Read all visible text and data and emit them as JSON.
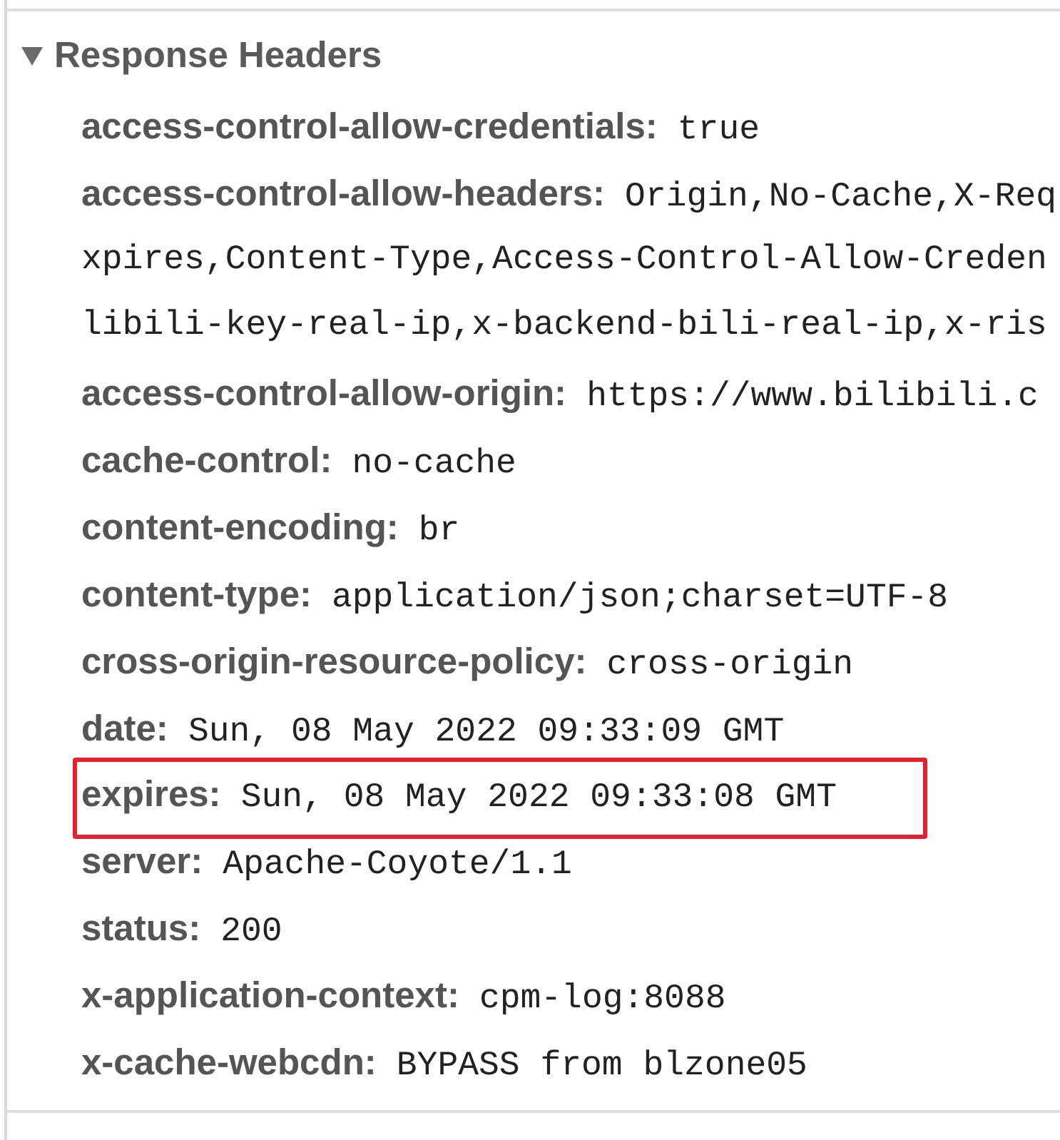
{
  "section": {
    "title": "Response Headers",
    "expanded": true
  },
  "headers": [
    {
      "name": "access-control-allow-credentials:",
      "value_lines": [
        "true"
      ],
      "highlighted": false
    },
    {
      "name": "access-control-allow-headers:",
      "value_lines": [
        "Origin,No-Cache,X-Req",
        "xpires,Content-Type,Access-Control-Allow-Creden",
        "libili-key-real-ip,x-backend-bili-real-ip,x-ris"
      ],
      "highlighted": false
    },
    {
      "name": "access-control-allow-origin:",
      "value_lines": [
        "https://www.bilibili.c"
      ],
      "highlighted": false
    },
    {
      "name": "cache-control:",
      "value_lines": [
        "no-cache"
      ],
      "highlighted": false
    },
    {
      "name": "content-encoding:",
      "value_lines": [
        "br"
      ],
      "highlighted": false
    },
    {
      "name": "content-type:",
      "value_lines": [
        "application/json;charset=UTF-8"
      ],
      "highlighted": false
    },
    {
      "name": "cross-origin-resource-policy:",
      "value_lines": [
        "cross-origin"
      ],
      "highlighted": false
    },
    {
      "name": "date:",
      "value_lines": [
        "Sun, 08 May 2022 09:33:09 GMT"
      ],
      "highlighted": false
    },
    {
      "name": "expires:",
      "value_lines": [
        "Sun, 08 May 2022 09:33:08 GMT"
      ],
      "highlighted": true
    },
    {
      "name": "server:",
      "value_lines": [
        "Apache-Coyote/1.1"
      ],
      "highlighted": false
    },
    {
      "name": "status:",
      "value_lines": [
        "200"
      ],
      "highlighted": false
    },
    {
      "name": "x-application-context:",
      "value_lines": [
        "cpm-log:8088"
      ],
      "highlighted": false
    },
    {
      "name": "x-cache-webcdn:",
      "value_lines": [
        "BYPASS from blzone05"
      ],
      "highlighted": false
    }
  ]
}
